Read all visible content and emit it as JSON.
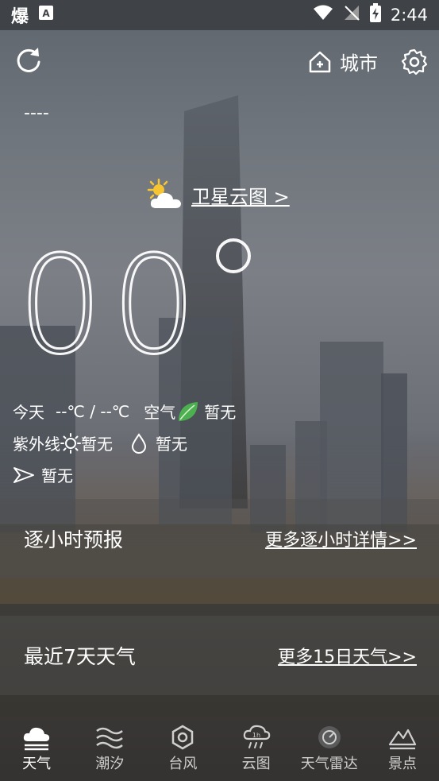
{
  "status_bar": {
    "app_glyph": "爆",
    "time": "2:44"
  },
  "header": {
    "refresh_icon": "refresh-icon",
    "city_label": "城市",
    "settings_icon": "gear-icon",
    "location_placeholder": "----"
  },
  "weather": {
    "satellite_link": "卫星云图 >",
    "temperature": "00",
    "today_label": "今天",
    "temp_range": "--℃ / --℃",
    "air_label": "空气",
    "air_value": "暂无",
    "uv_label": "紫外线",
    "uv_value": "暂无",
    "humidity_value": "暂无",
    "wind_value": "暂无"
  },
  "sections": {
    "hourly_title": "逐小时预报",
    "hourly_link": "更多逐小时详情>>",
    "week_title": "最近7天天气",
    "week_link": "更多15日天气>>"
  },
  "nav": {
    "items": [
      {
        "label": "天气",
        "icon": "cloud-icon"
      },
      {
        "label": "潮汐",
        "icon": "waves-icon"
      },
      {
        "label": "台风",
        "icon": "typhoon-icon"
      },
      {
        "label": "云图",
        "icon": "cloud-rain-icon"
      },
      {
        "label": "天气雷达",
        "icon": "radar-icon"
      },
      {
        "label": "景点",
        "icon": "mountain-icon"
      }
    ]
  }
}
